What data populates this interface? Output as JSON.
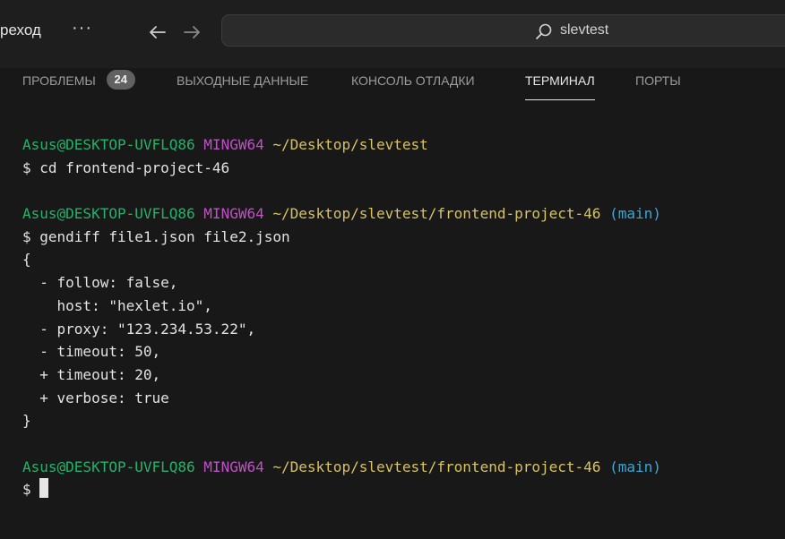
{
  "titlebar": {
    "menu_label": "реход",
    "more_label": "···",
    "search_text": "slevtest"
  },
  "panel": {
    "tabs": [
      {
        "label": "ПРОБЛЕМЫ",
        "badge": "24",
        "active": false
      },
      {
        "label": "ВЫХОДНЫЕ ДАННЫЕ",
        "active": false
      },
      {
        "label": "КОНСОЛЬ ОТЛАДКИ",
        "active": false
      },
      {
        "label": "ТЕРМИНАЛ",
        "active": true
      },
      {
        "label": "ПОРТЫ",
        "active": false
      }
    ]
  },
  "terminal": {
    "prompt1": {
      "user": "Asus@DESKTOP-UVFLQ86",
      "env": "MINGW64",
      "path": "~/Desktop/slevtest"
    },
    "command1": "$ cd frontend-project-46",
    "prompt2": {
      "user": "Asus@DESKTOP-UVFLQ86",
      "env": "MINGW64",
      "path": "~/Desktop/slevtest/frontend-project-46",
      "branch": "(main)"
    },
    "command2": "$ gendiff file1.json file2.json",
    "output": [
      "{",
      "  - follow: false,",
      "    host: \"hexlet.io\",",
      "  - proxy: \"123.234.53.22\",",
      "  - timeout: 50,",
      "  + timeout: 20,",
      "  + verbose: true",
      "}"
    ],
    "prompt3": {
      "user": "Asus@DESKTOP-UVFLQ86",
      "env": "MINGW64",
      "path": "~/Desktop/slevtest/frontend-project-46",
      "branch": "(main)"
    },
    "input_prompt": "$ "
  },
  "colors": {
    "user": "#23b36b",
    "env": "#c051c9",
    "path": "#d7c35f",
    "branch": "#3aa8d8",
    "background": "#181818"
  }
}
